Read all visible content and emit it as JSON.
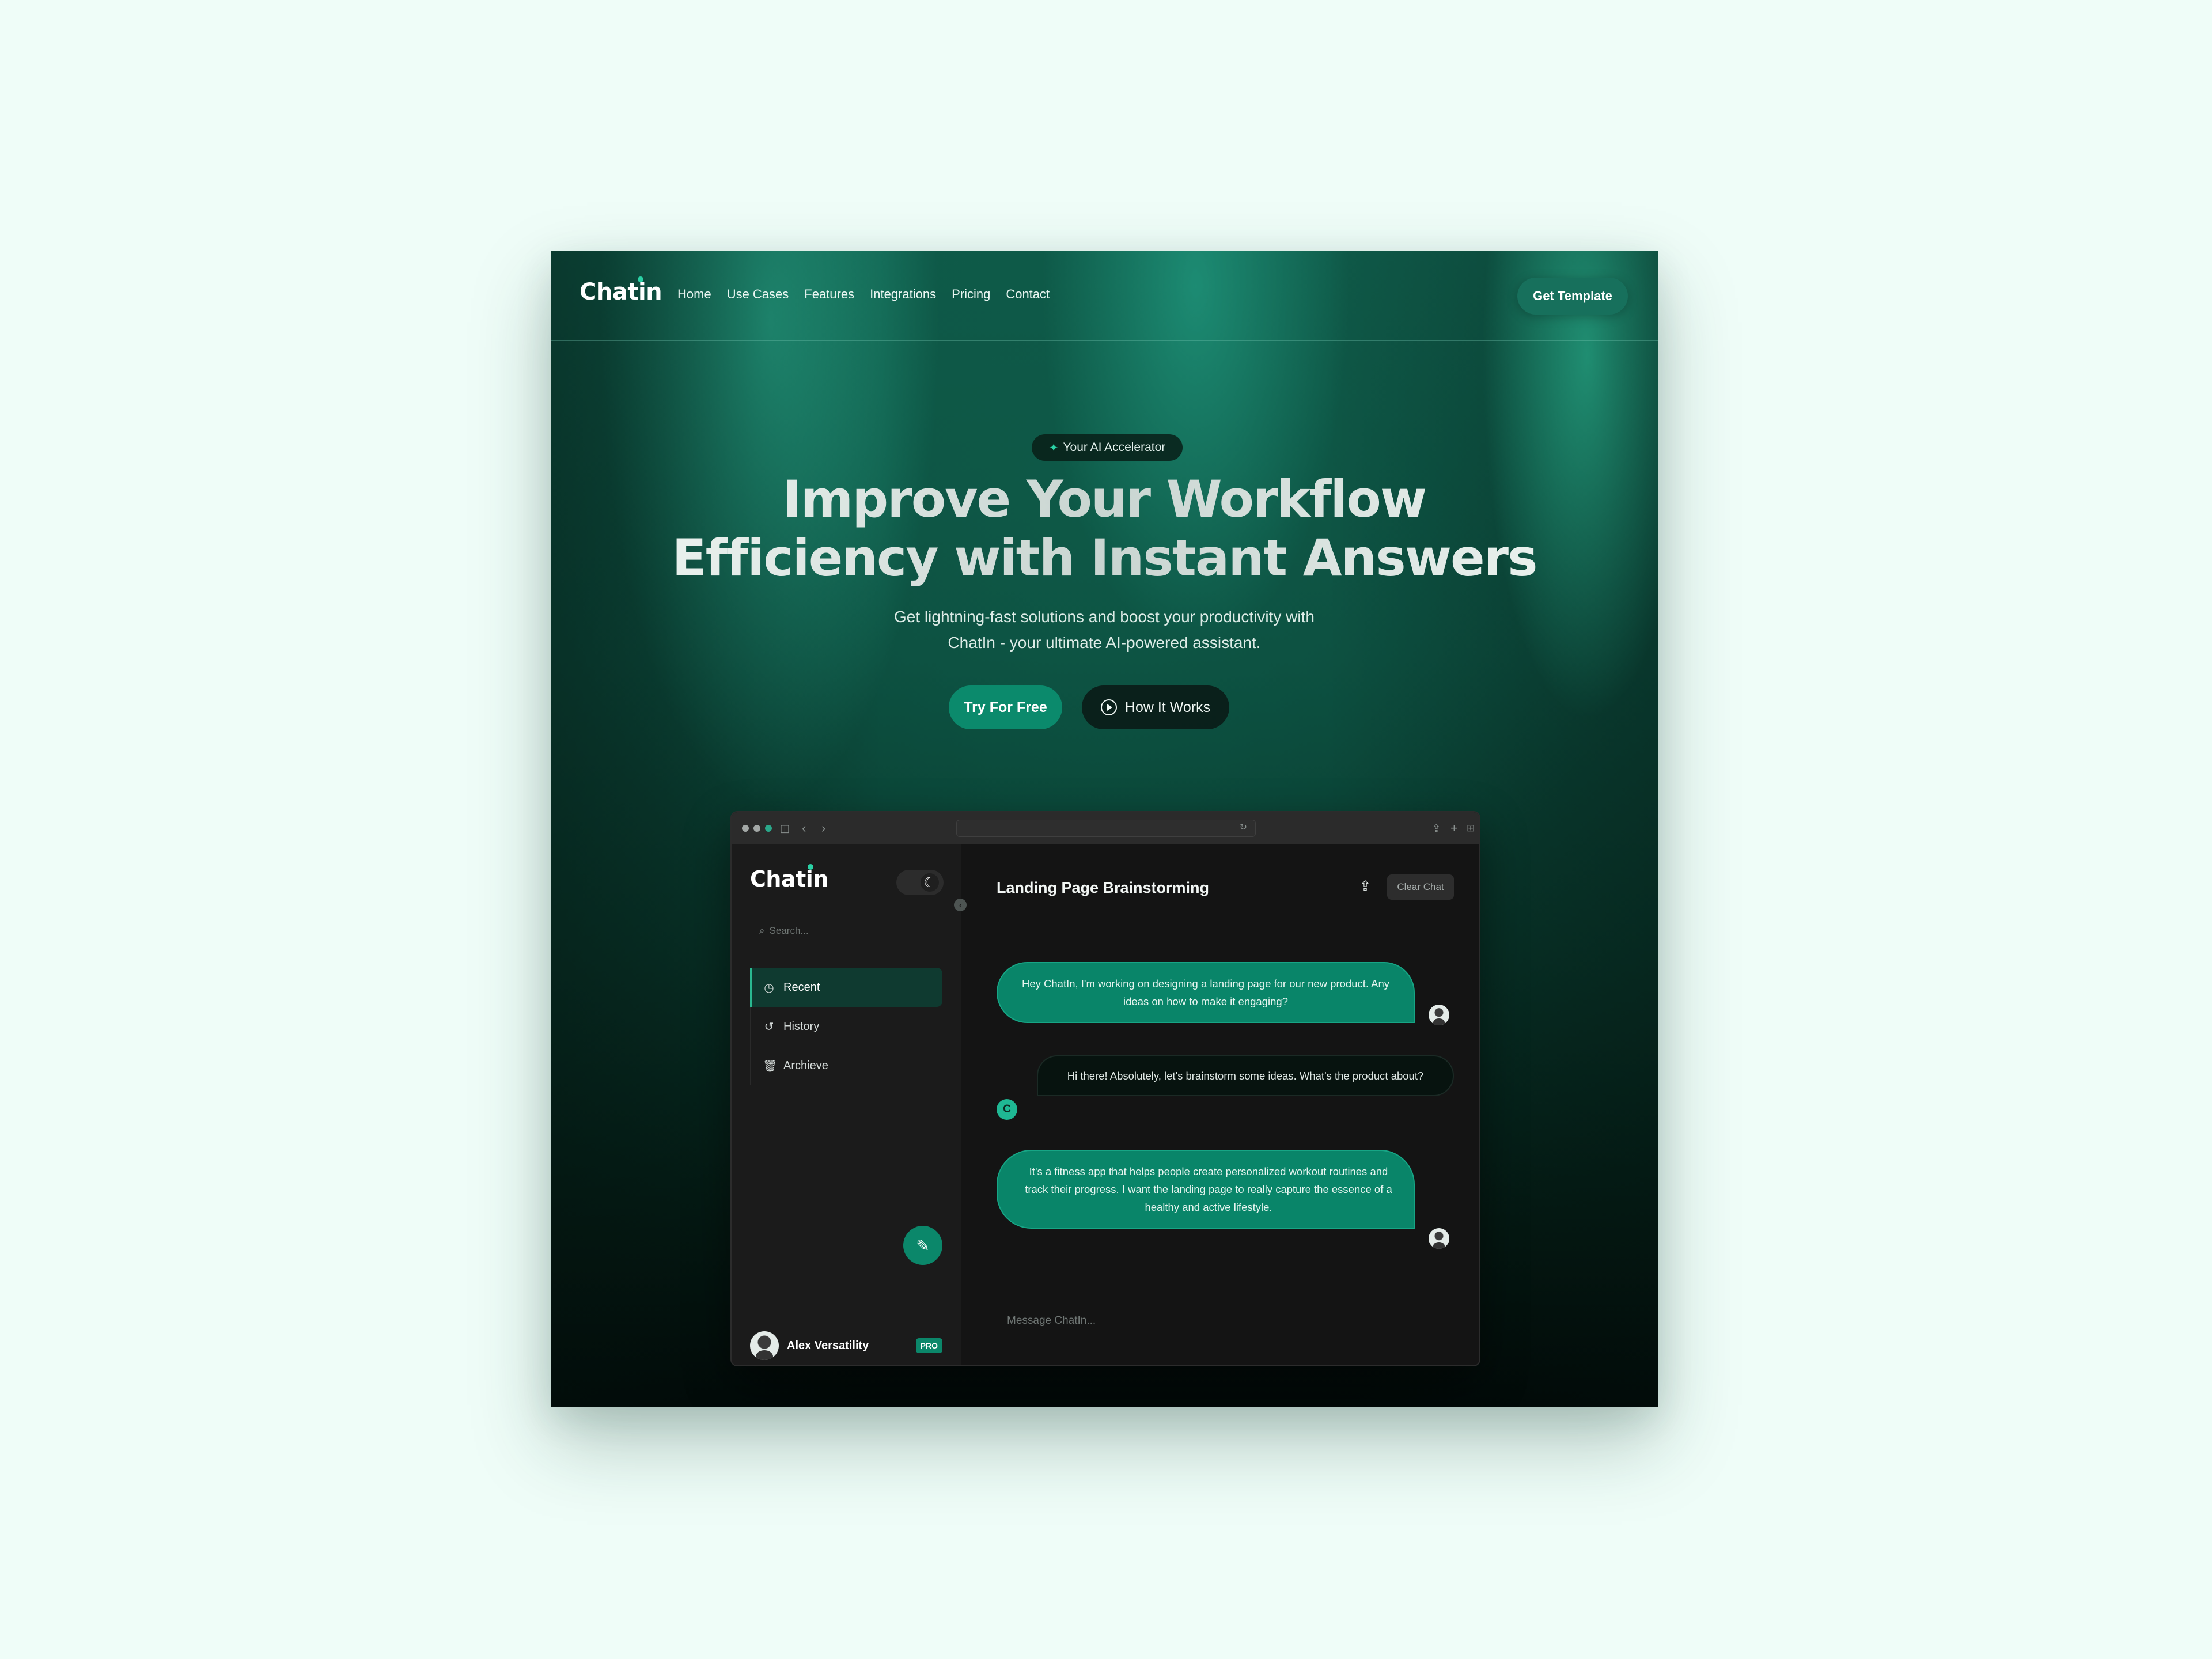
{
  "brand": {
    "name": "Chatin",
    "accent": "#2ad1a5",
    "primary_button": "#0b8a6c"
  },
  "nav": {
    "links": [
      "Home",
      "Use Cases",
      "Features",
      "Integrations",
      "Pricing",
      "Contact"
    ],
    "cta_label": "Get Template"
  },
  "hero": {
    "badge_icon": "sparkle-icon",
    "badge": "Your AI Accelerator",
    "title_line1": "Improve Your Workflow",
    "title_line2": "Efficiency with Instant Answers",
    "subtitle_line1": "Get lightning-fast solutions and boost your productivity with",
    "subtitle_line2": "ChatIn - your ultimate AI-powered assistant.",
    "primary_cta": "Try For Free",
    "secondary_cta": "How It Works",
    "secondary_cta_icon": "play-circle-icon"
  },
  "app": {
    "logo": "Chatin",
    "theme_toggle_icon": "moon-icon",
    "search_placeholder": "Search...",
    "sidebar_items": [
      {
        "label": "Recent",
        "icon": "clock-icon",
        "active": true
      },
      {
        "label": "History",
        "icon": "history-icon",
        "active": false
      },
      {
        "label": "Archieve",
        "icon": "trash-icon",
        "active": false
      }
    ],
    "new_chat_icon": "pencil-icon",
    "user": {
      "name": "Alex Versatility",
      "plan": "PRO"
    },
    "chat": {
      "title": "Landing Page Brainstorming",
      "share_icon": "share-icon",
      "clear_label": "Clear Chat",
      "messages": [
        {
          "role": "user",
          "text": "Hey ChatIn, I'm working on designing a landing page for our new product. Any ideas on how to make it engaging?"
        },
        {
          "role": "bot",
          "avatar_letter": "C",
          "text": "Hi there! Absolutely, let's brainstorm some ideas. What's the product about?"
        },
        {
          "role": "user",
          "text": "It's a fitness app that helps people create personalized workout routines and track their progress. I want the landing page to really capture the essence of a healthy and active lifestyle."
        }
      ],
      "input_placeholder": "Message ChatIn..."
    }
  }
}
